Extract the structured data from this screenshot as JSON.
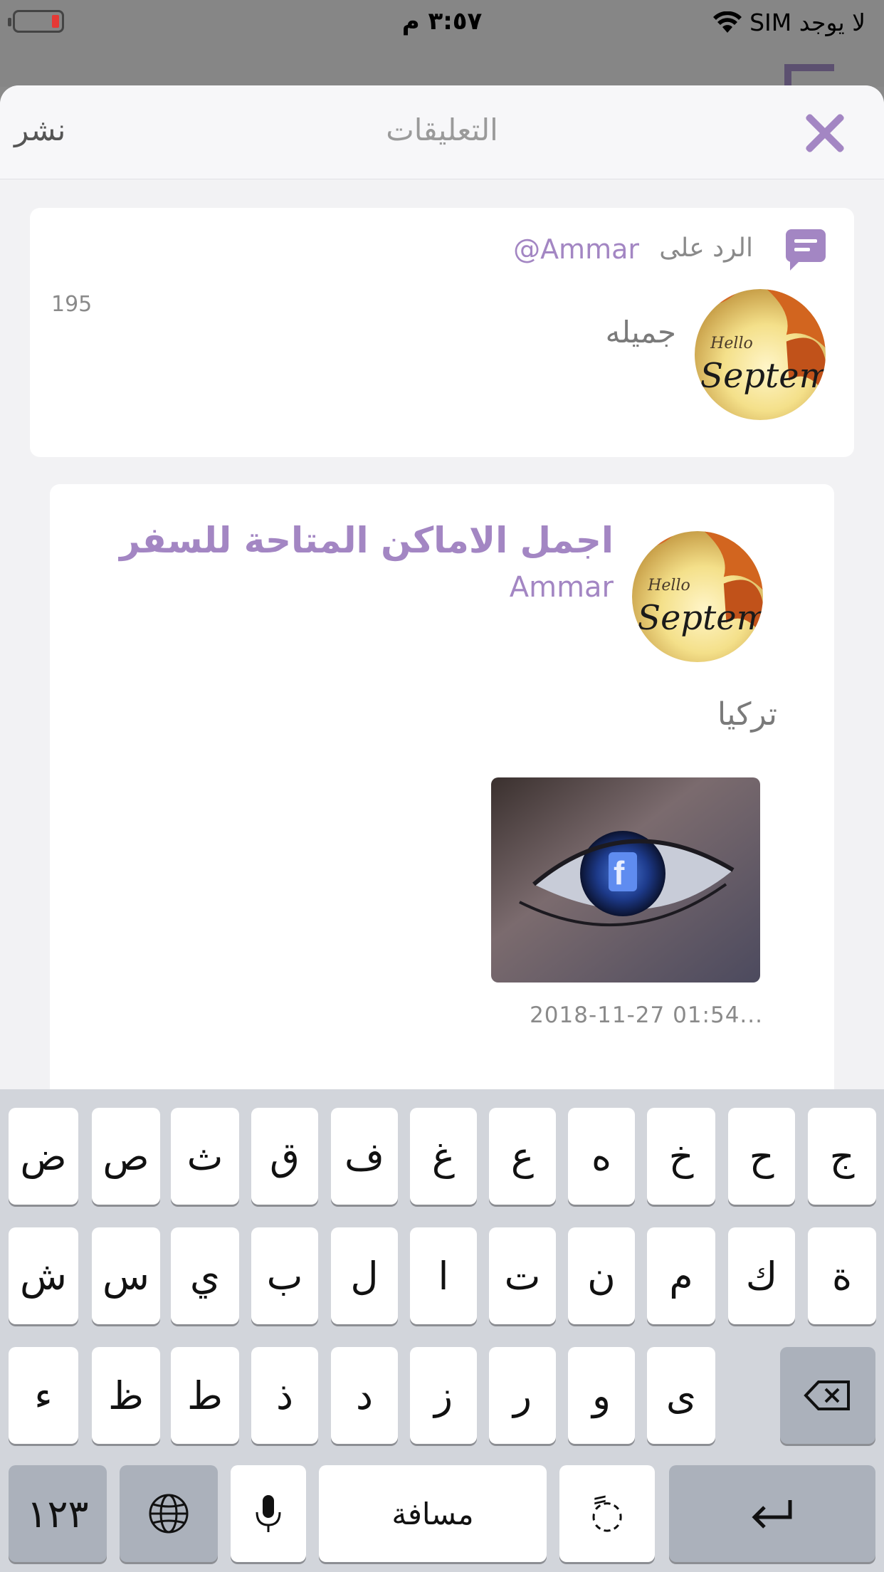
{
  "status_bar": {
    "carrier": "لا يوجد SIM",
    "time": "٣:٥٧ م",
    "battery_level": 0.1
  },
  "sheet": {
    "title": "التعليقات",
    "publish_label": "نشر",
    "accent_color": "#a386c3"
  },
  "comment": {
    "reply_label": "الرد على",
    "reply_user": "@Ammar",
    "text": "جميله",
    "count": "195",
    "avatar_text": "Hello Septem"
  },
  "post": {
    "title": "اجمل الاماكن المتاحة للسفر",
    "author": "Ammar",
    "text": "تركيا",
    "date": "2018-11-27   01:54...",
    "avatar_text": "Hello Septem"
  },
  "keyboard": {
    "row1": [
      "ض",
      "ص",
      "ث",
      "ق",
      "ف",
      "غ",
      "ع",
      "ه",
      "خ",
      "ح",
      "ج"
    ],
    "row2": [
      "ش",
      "س",
      "ي",
      "ب",
      "ل",
      "ا",
      "ت",
      "ن",
      "م",
      "ك",
      "ة"
    ],
    "row3": [
      "ء",
      "ظ",
      "ط",
      "ذ",
      "د",
      "ز",
      "ر",
      "و",
      "ى"
    ],
    "numbers_label": "١٢٣",
    "space_label": "مسافة",
    "diacritic_label": "ً◌"
  }
}
